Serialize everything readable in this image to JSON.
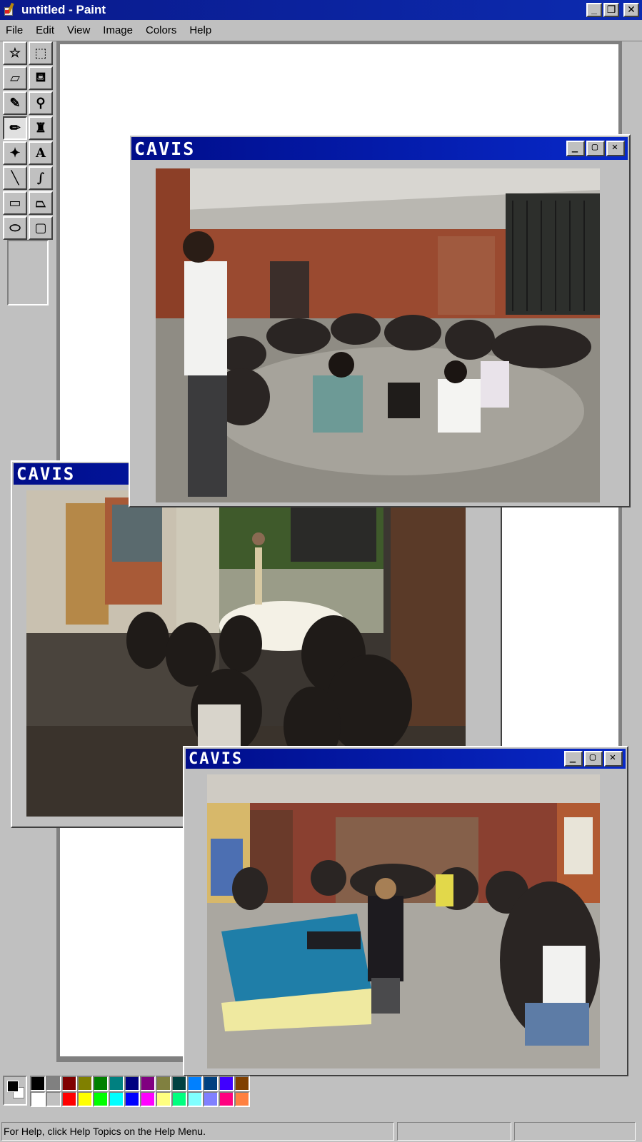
{
  "window": {
    "title": "untitled - Paint",
    "buttons": {
      "minimize": "_",
      "restore": "❐",
      "close": "✕"
    }
  },
  "menu": [
    "File",
    "Edit",
    "View",
    "Image",
    "Colors",
    "Help"
  ],
  "tools": [
    {
      "name": "free-select",
      "icon": "free-form-select-icon",
      "glyph": "☆"
    },
    {
      "name": "rect-select",
      "icon": "rect-select-icon",
      "glyph": "⬚"
    },
    {
      "name": "eraser",
      "icon": "eraser-icon",
      "glyph": "▱"
    },
    {
      "name": "fill",
      "icon": "fill-bucket-icon",
      "glyph": "⛾"
    },
    {
      "name": "pick-color",
      "icon": "eyedropper-icon",
      "glyph": "✎"
    },
    {
      "name": "magnifier",
      "icon": "magnifier-icon",
      "glyph": "⚲"
    },
    {
      "name": "pencil",
      "icon": "pencil-icon",
      "glyph": "✏"
    },
    {
      "name": "brush",
      "icon": "brush-icon",
      "glyph": "♜"
    },
    {
      "name": "airbrush",
      "icon": "airbrush-icon",
      "glyph": "✦"
    },
    {
      "name": "text",
      "icon": "text-icon",
      "glyph": "A"
    },
    {
      "name": "line",
      "icon": "line-icon",
      "glyph": "╲"
    },
    {
      "name": "curve",
      "icon": "curve-icon",
      "glyph": "∫"
    },
    {
      "name": "rectangle",
      "icon": "rectangle-icon",
      "glyph": "▭"
    },
    {
      "name": "polygon",
      "icon": "polygon-icon",
      "glyph": "⏢"
    },
    {
      "name": "ellipse",
      "icon": "ellipse-icon",
      "glyph": "⬭"
    },
    {
      "name": "rounded-rect",
      "icon": "rounded-rect-icon",
      "glyph": "▢"
    }
  ],
  "active_tool": "pencil",
  "windows": [
    {
      "id": "cavis-1",
      "title": "CAVIS",
      "photo": "students sitting in a circle on a concrete floor"
    },
    {
      "id": "cavis-2",
      "title": "CAVIS",
      "photo": "group gathered in courtyard with guitarist"
    },
    {
      "id": "cavis-3",
      "title": "CAVIS",
      "photo": "meeting around a pool table in a graffiti room"
    }
  ],
  "palette": {
    "foreground": "#000000",
    "background": "#ffffff",
    "row1": [
      "#000000",
      "#808080",
      "#800000",
      "#808000",
      "#008000",
      "#008080",
      "#000080",
      "#800080",
      "#808040",
      "#004040",
      "#0080ff",
      "#004080",
      "#4000ff",
      "#804000"
    ],
    "row2": [
      "#ffffff",
      "#c0c0c0",
      "#ff0000",
      "#ffff00",
      "#00ff00",
      "#00ffff",
      "#0000ff",
      "#ff00ff",
      "#ffff80",
      "#00ff80",
      "#80ffff",
      "#8080ff",
      "#ff0080",
      "#ff8040"
    ]
  },
  "status": {
    "help": "For Help, click Help Topics on the Help Menu."
  }
}
